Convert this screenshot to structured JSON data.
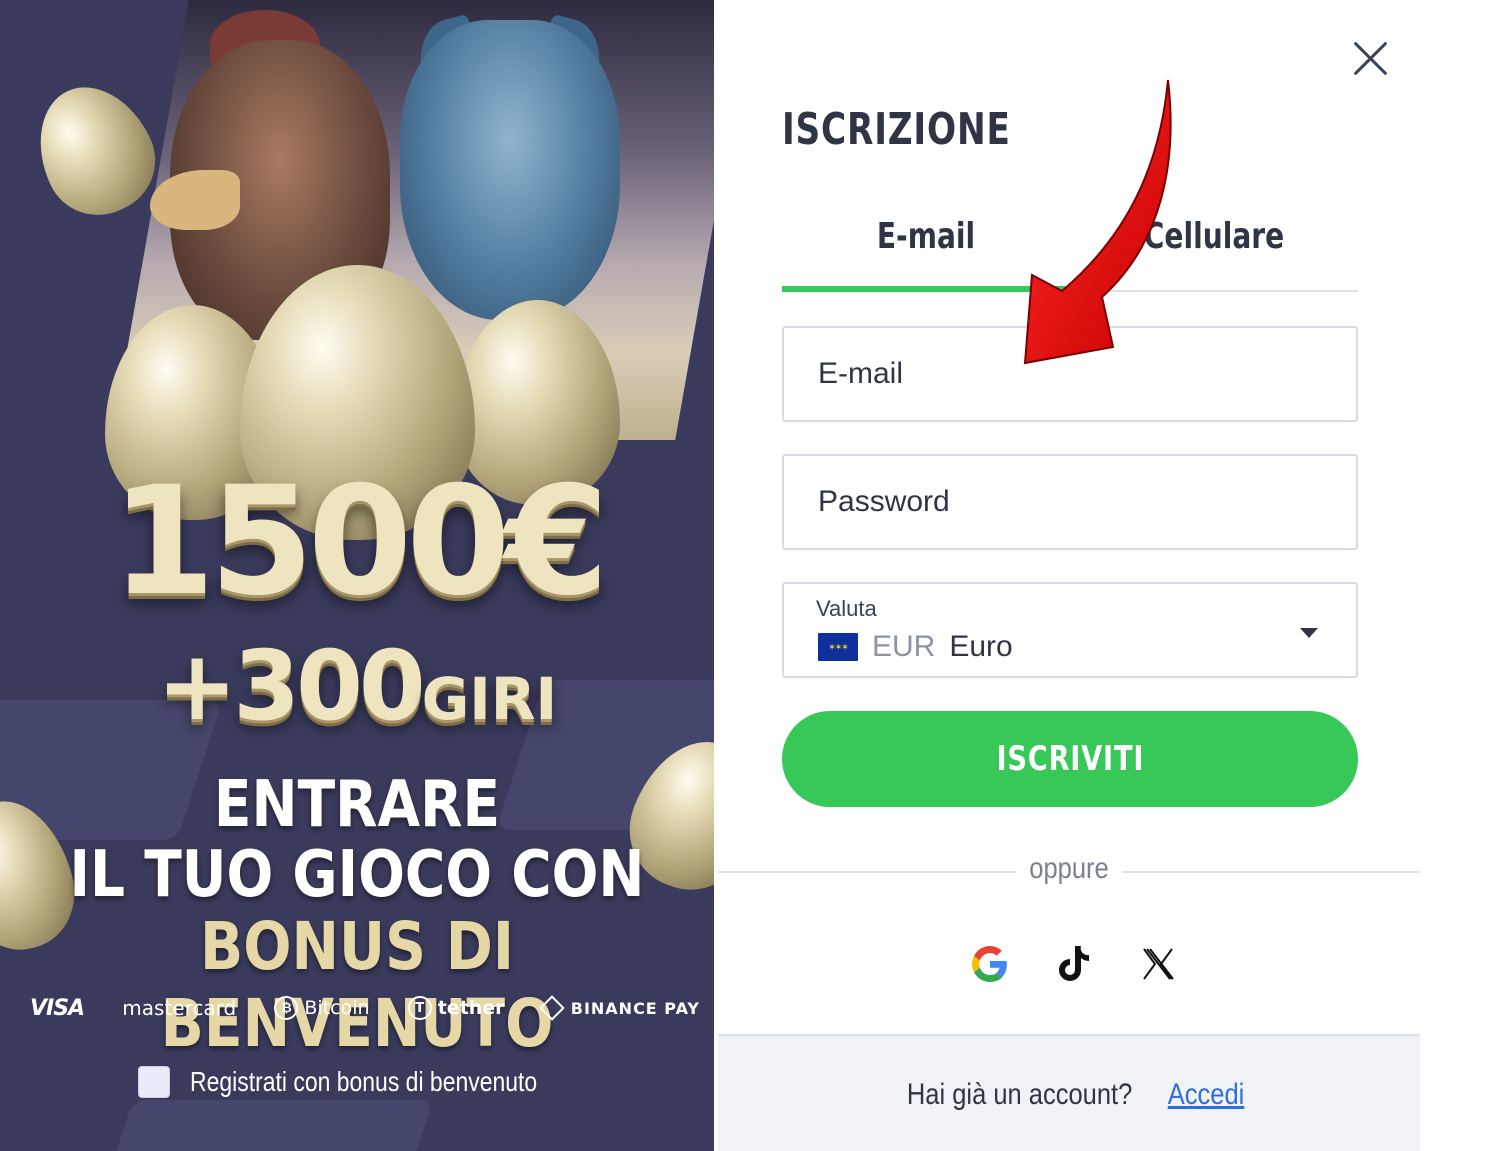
{
  "promo": {
    "amount": "1500€",
    "spins_number": "+300",
    "spins_unit": "GIRI",
    "line1": "ENTRARE",
    "line2": "IL TUO GIOCO CON",
    "line3": "BONUS DI BENVENUTO",
    "payments": [
      {
        "label": "VISA",
        "icon": "visa-logo"
      },
      {
        "label": "mastercard",
        "icon": "mastercard-logo"
      },
      {
        "label": "Bitcoin",
        "icon": "bitcoin-icon"
      },
      {
        "label": "tether",
        "icon": "tether-icon"
      },
      {
        "label": "BINANCE PAY",
        "icon": "binance-icon"
      }
    ],
    "bonus_checkbox_label": "Registrati con bonus di benvenuto",
    "bonus_checked": false
  },
  "form": {
    "title": "ISCRIZIONE",
    "tabs": [
      {
        "label": "E-mail",
        "active": true
      },
      {
        "label": "Cellulare",
        "active": false
      }
    ],
    "email_placeholder": "E-mail",
    "password_placeholder": "Password",
    "currency": {
      "label": "Valuta",
      "code": "EUR",
      "name": "Euro",
      "flag": "eu-flag-icon"
    },
    "submit_label": "ISCRIVITI",
    "divider_text": "oppure",
    "social_logins": [
      "google-icon",
      "tiktok-icon",
      "x-icon"
    ],
    "footer_question": "Hai già un account?",
    "footer_link": "Accedi"
  },
  "colors": {
    "accent_green": "#37c858",
    "promo_bg": "#3a3a5c",
    "gold_text": "#e6d7a6",
    "link_blue": "#2d6fe0",
    "annotation_arrow": "#e10000"
  }
}
